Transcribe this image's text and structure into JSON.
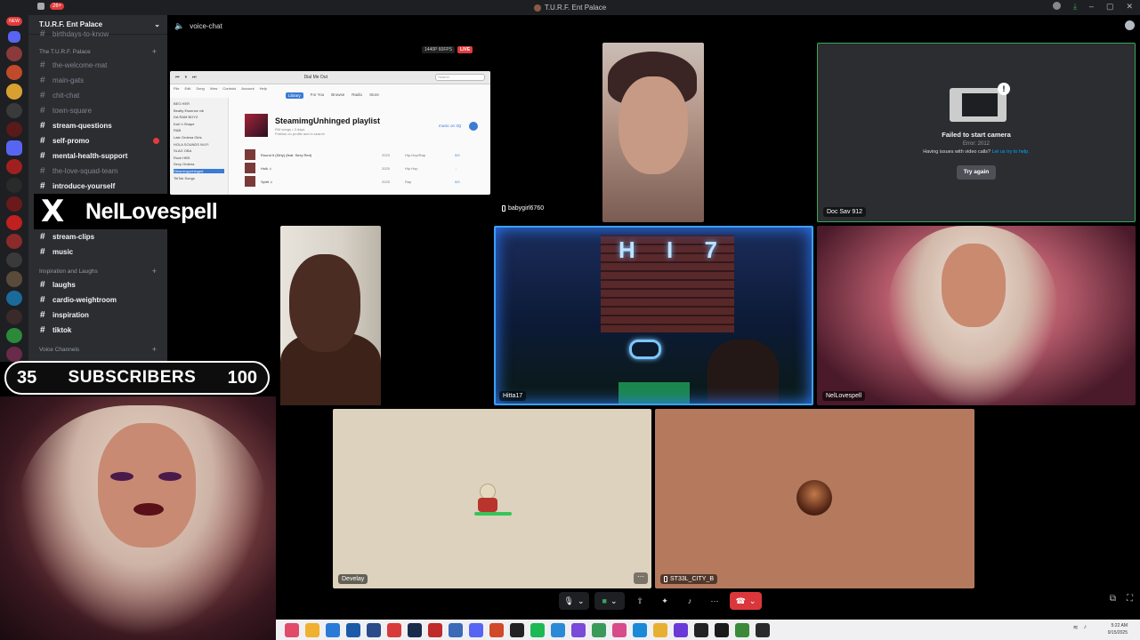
{
  "titlebar": {
    "title": "T.U.R.F. Ent Palace",
    "notif_badge": "26+"
  },
  "rail": {
    "new_label": "NEW",
    "badges": [
      "8",
      "",
      "",
      "6",
      "",
      "",
      "",
      "",
      "",
      "",
      "",
      "",
      "",
      "99+",
      "",
      "",
      "",
      "",
      "30",
      "",
      "56",
      "",
      "",
      "",
      ""
    ]
  },
  "server": {
    "name": "T.U.R.F. Ent Palace",
    "top_channel": "birthdays-to-know",
    "category_1": "The T.U.R.F. Palace",
    "channels_1": [
      {
        "name": "the-welcome-mat",
        "bright": false
      },
      {
        "name": "main-gats",
        "bright": false
      },
      {
        "name": "chit-chat",
        "bright": false
      },
      {
        "name": "town-square",
        "bright": false
      },
      {
        "name": "stream-questions",
        "bright": true
      },
      {
        "name": "self-promo",
        "bright": true
      },
      {
        "name": "mental-health-support",
        "bright": true
      },
      {
        "name": "the-love-squad-team",
        "bright": false
      },
      {
        "name": "introduce-yourself",
        "bright": true
      }
    ],
    "channels_hidden": [
      {
        "name": "stream-clips",
        "bright": true
      },
      {
        "name": "music",
        "bright": true
      }
    ],
    "category_2": "Inspiration and Laughs",
    "channels_2": [
      {
        "name": "laughs",
        "bright": true
      },
      {
        "name": "cardio-weightroom",
        "bright": true
      },
      {
        "name": "inspiration",
        "bright": true
      },
      {
        "name": "tiktok",
        "bright": true
      }
    ],
    "category_3": "Voice Channels"
  },
  "overlay": {
    "x_handle": "NelLovespell",
    "subs_current": "35",
    "subs_label": "SUBSCRIBERS",
    "subs_goal": "100"
  },
  "voice": {
    "channel_name": "voice-chat"
  },
  "share": {
    "quality": "1440P 60FPS",
    "live": "LIVE",
    "now_playing": "Dial Me Out",
    "search_placeholder": "Search",
    "menu": [
      "File",
      "Edit",
      "Song",
      "View",
      "Controls",
      "Account",
      "Help"
    ],
    "tabs": [
      "Library",
      "For You",
      "Browse",
      "Radio",
      "Store"
    ],
    "sidebar": [
      "BEG HER",
      "Beatty Essence vib",
      "DA RAM BOYZ",
      "Kall 'n Shape",
      "R&B",
      "Late Ordena Girls",
      "HOLA SOUNDS Wi-Fi",
      "SLAG OBA",
      "Rock HBS",
      "Sexy Ordena",
      "Steamingunhinged",
      "TikTok Songs"
    ],
    "playlist_title": "SteamimgUnhinged playlist",
    "playlist_meta": "RM songs • 3 days",
    "playlist_share": "Publish on profile and in search",
    "more_link": "music on 3Q",
    "rows": [
      {
        "title": "Round It (Dirty) (feat. Sexy Red)",
        "year": "2023",
        "genre": "Hip-Hop/Rap",
        "num": "0/0"
      },
      {
        "title": "Hulk ♫",
        "year": "2025",
        "genre": "Hip Hop",
        "num": "..."
      },
      {
        "title": "Spirit ♫",
        "year": "2025",
        "genre": "Rap",
        "num": "0/0"
      }
    ]
  },
  "tiles": {
    "baby": {
      "name": "babygirl6760"
    },
    "doc": {
      "name": "Doc Sav 912",
      "heading": "Failed to start camera",
      "error": "Error: 2012",
      "help_prefix": "Having issues with video calls?",
      "help_link": "Let us try to help.",
      "try_again": "Try again"
    },
    "hitta": {
      "name": "Hitta17"
    },
    "nell": {
      "name": "NelLovespell"
    },
    "dev": {
      "name": "Develay",
      "more": "⋯"
    },
    "st": {
      "name": "ST33L_CITY_B"
    }
  },
  "controls": {
    "mic": "🎙",
    "cam": "■",
    "share": "⇧",
    "activity": "✦",
    "soundboard": "♪",
    "more": "⋯",
    "hangup": "☎"
  },
  "taskbar": {
    "time": "5:22 AM",
    "date": "9/15/2025"
  },
  "colors": {
    "accent": "#5865f2",
    "live": "#e23b3b",
    "hangup": "#da373c",
    "green": "#3ba55c"
  }
}
